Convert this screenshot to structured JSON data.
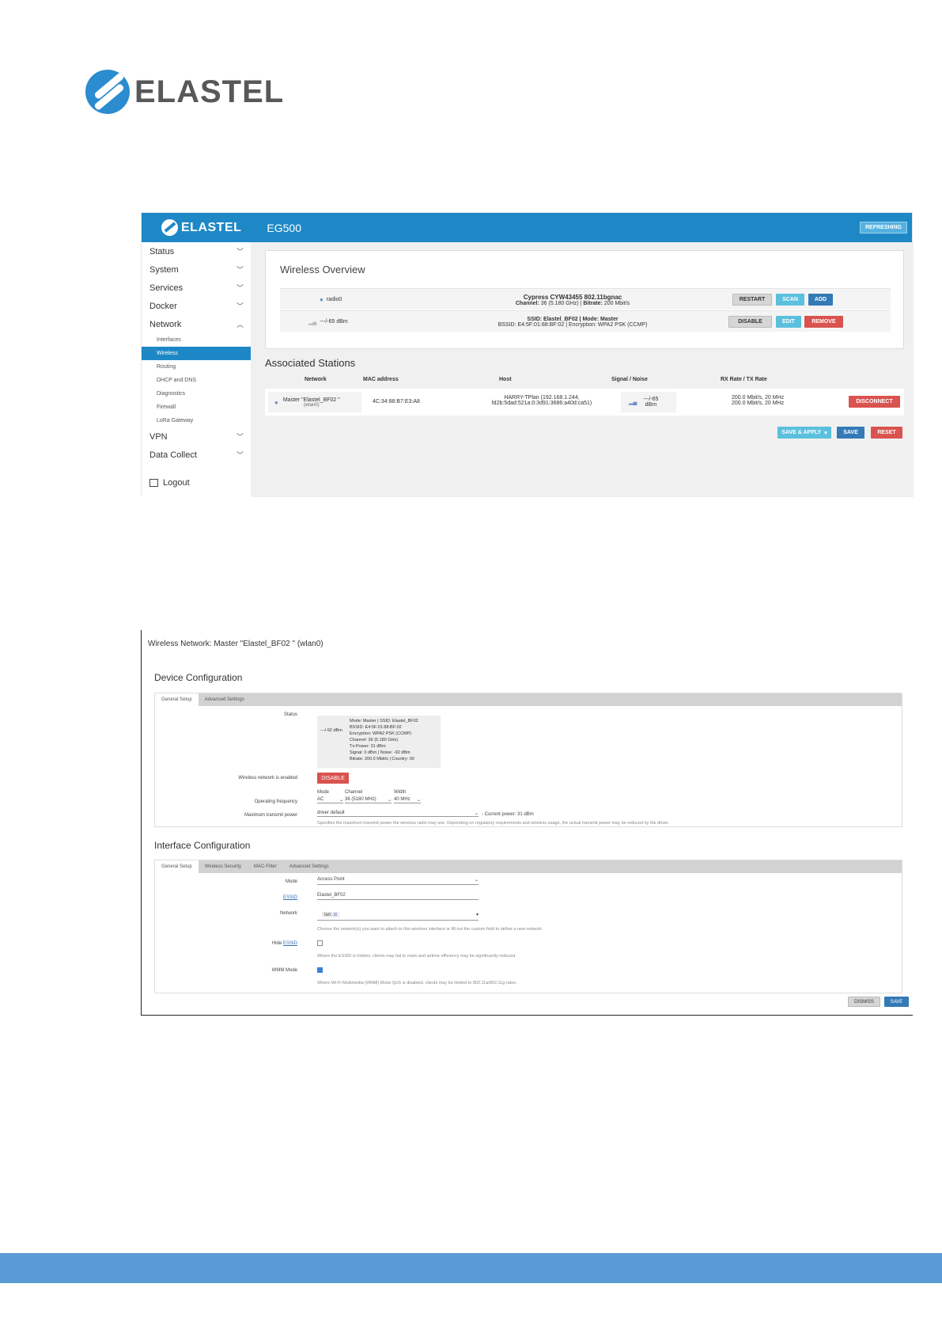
{
  "doc_logo": {
    "text": "ELASTEL"
  },
  "shot1": {
    "brand": "ELASTEL",
    "model": "EG500",
    "refresh_badge": "REFRESHING",
    "sidebar": {
      "items": [
        "Status",
        "System",
        "Services",
        "Docker",
        "Network"
      ],
      "network_sub": [
        "Interfaces",
        "Wireless",
        "Routing",
        "DHCP and DNS",
        "Diagnostics",
        "Firewall",
        "LoRa Gateway"
      ],
      "items_after": [
        "VPN",
        "Data Collect"
      ],
      "logout": "Logout"
    },
    "overview": {
      "title": "Wireless Overview",
      "radio_name": "radio0",
      "device_title": "Cypress CYW43455 802.11bgnac",
      "device_info_channel_label": "Channel:",
      "device_info_channel": "36 (5.180 GHz)",
      "device_info_bitrate_label": "Bitrate:",
      "device_info_bitrate": "200 Mbit/s",
      "signal": "---/-65 dBm",
      "ssid_line": "SSID: Elastel_BF02 | Mode: Master",
      "bssid_line": "BSSID: E4:5F:01:88:BF:02 | Encryption: WPA2 PSK (CCMP)",
      "buttons": {
        "restart": "RESTART",
        "scan": "SCAN",
        "add": "ADD",
        "disable": "DISABLE",
        "edit": "EDIT",
        "remove": "REMOVE"
      }
    },
    "stations": {
      "title": "Associated Stations",
      "headers": [
        "Network",
        "MAC address",
        "Host",
        "Signal / Noise",
        "RX Rate / TX Rate"
      ],
      "network": "Master \"Elastel_BF02 \"",
      "network_sub": "(wlan0)",
      "mac": "4C:34:88:B7:E3:A8",
      "host1": "HARRY-TPlan (192.168.1.244,",
      "host2": "fd2b:5dad:521a:0:3d91:3686:a40d:ca51)",
      "signal1": "---/-65",
      "signal2": "dBm",
      "rate1": "200.0 Mbit/s, 20 MHz",
      "rate2": "200.0 Mbit/s, 20 MHz",
      "disconnect": "DISCONNECT"
    },
    "actions": {
      "save_apply": "SAVE & APPLY",
      "save": "SAVE",
      "reset": "RESET"
    }
  },
  "shot2": {
    "title": "Wireless Network: Master \"Elastel_BF02 \" (wlan0)",
    "device_config": {
      "title": "Device Configuration",
      "tabs": [
        "General Setup",
        "Advanced Settings"
      ],
      "status_label": "Status",
      "status_signal": "---/-92 dBm",
      "status_lines": [
        "Mode: Master | SSID: Elastel_BF02",
        "BSSID: E4:5F:01:88:BF:02",
        "Encryption: WPA2 PSK (CCMP)",
        "Channel: 36 (5.180 GHz)",
        "Tx-Power: 31 dBm",
        "Signal: 0 dBm | Noise: -92 dBm",
        "Bitrate: 200.0 Mbit/s | Country: 00"
      ],
      "enabled_label": "Wireless network is enabled",
      "disable_btn": "DISABLE",
      "freq_label": "Operating frequency",
      "mode_head": "Mode",
      "channel_head": "Channel",
      "width_head": "Width",
      "mode_val": "AC",
      "channel_val": "36 (5180 MHz)",
      "width_val": "40 MHz",
      "txpower_label": "Maximum transmit power",
      "txpower_val": "driver default",
      "txpower_current": "- Current power: 31 dBm",
      "txpower_help": "Specifies the maximum transmit power the wireless radio may use. Depending on regulatory requirements and wireless usage, the actual transmit power may be reduced by the driver."
    },
    "iface_config": {
      "title": "Interface Configuration",
      "tabs": [
        "General Setup",
        "Wireless Security",
        "MAC-Filter",
        "Advanced Settings"
      ],
      "mode_label": "Mode",
      "mode_val": "Access Point",
      "essid_label": "ESSID",
      "essid_val": "Elastel_BF02",
      "network_label": "Network",
      "network_val": "lan:",
      "network_help": "Choose the network(s) you want to attach to this wireless interface or fill out the custom field to define a new network.",
      "hide_label_pre": "Hide ",
      "hide_label_link": "ESSID",
      "hide_help": "Where the ESSID is hidden, clients may fail to roam and airtime efficiency may be significantly reduced.",
      "wmm_label": "WMM Mode",
      "wmm_help": "Where Wi-Fi Multimedia (WMM) Mode QoS is disabled, clients may be limited to 802.11a/802.11g rates."
    },
    "buttons": {
      "dismiss": "DISMISS",
      "save": "SAVE"
    }
  }
}
